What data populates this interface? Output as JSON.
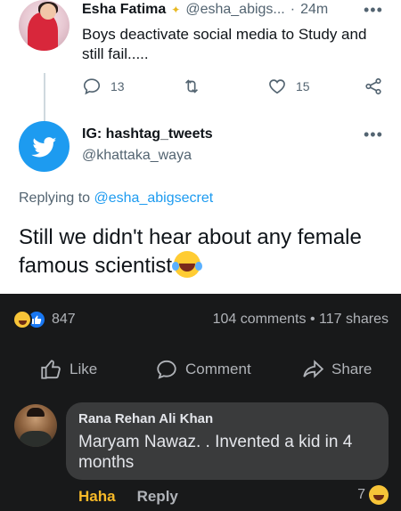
{
  "tweet1": {
    "display_name": "Esha Fatima",
    "handle": "@esha_abigs...",
    "separator": "·",
    "time": "24m",
    "text": "Boys deactivate social media to Study and still fail.....",
    "replies": "13",
    "likes": "15",
    "icons": [
      "reply-icon",
      "retweet-icon",
      "like-icon",
      "share-icon"
    ]
  },
  "tweet2": {
    "display_name": "IG: hashtag_tweets",
    "handle": "@khattaka_waya",
    "replying_prefix": "Replying to",
    "replying_to": "@esha_abigsecret",
    "text": "Still we didn't hear about any female famous scientist"
  },
  "facebook": {
    "reaction_count": "847",
    "comments": "104 comments",
    "stats_separator": "•",
    "shares": "117 shares",
    "like_label": "Like",
    "comment_label": "Comment",
    "share_label": "Share",
    "comment": {
      "author": "Rana Rehan Ali Khan",
      "text": "Maryam Nawaz. . Invented a kid in 4 months",
      "haha_label": "Haha",
      "reply_label": "Reply",
      "reaction_count": "7"
    }
  },
  "colors": {
    "twitter_blue": "#1d9bf0",
    "fb_dark": "#18191a",
    "fb_bubble": "#3a3b3c",
    "haha_yellow": "#f7b928"
  }
}
